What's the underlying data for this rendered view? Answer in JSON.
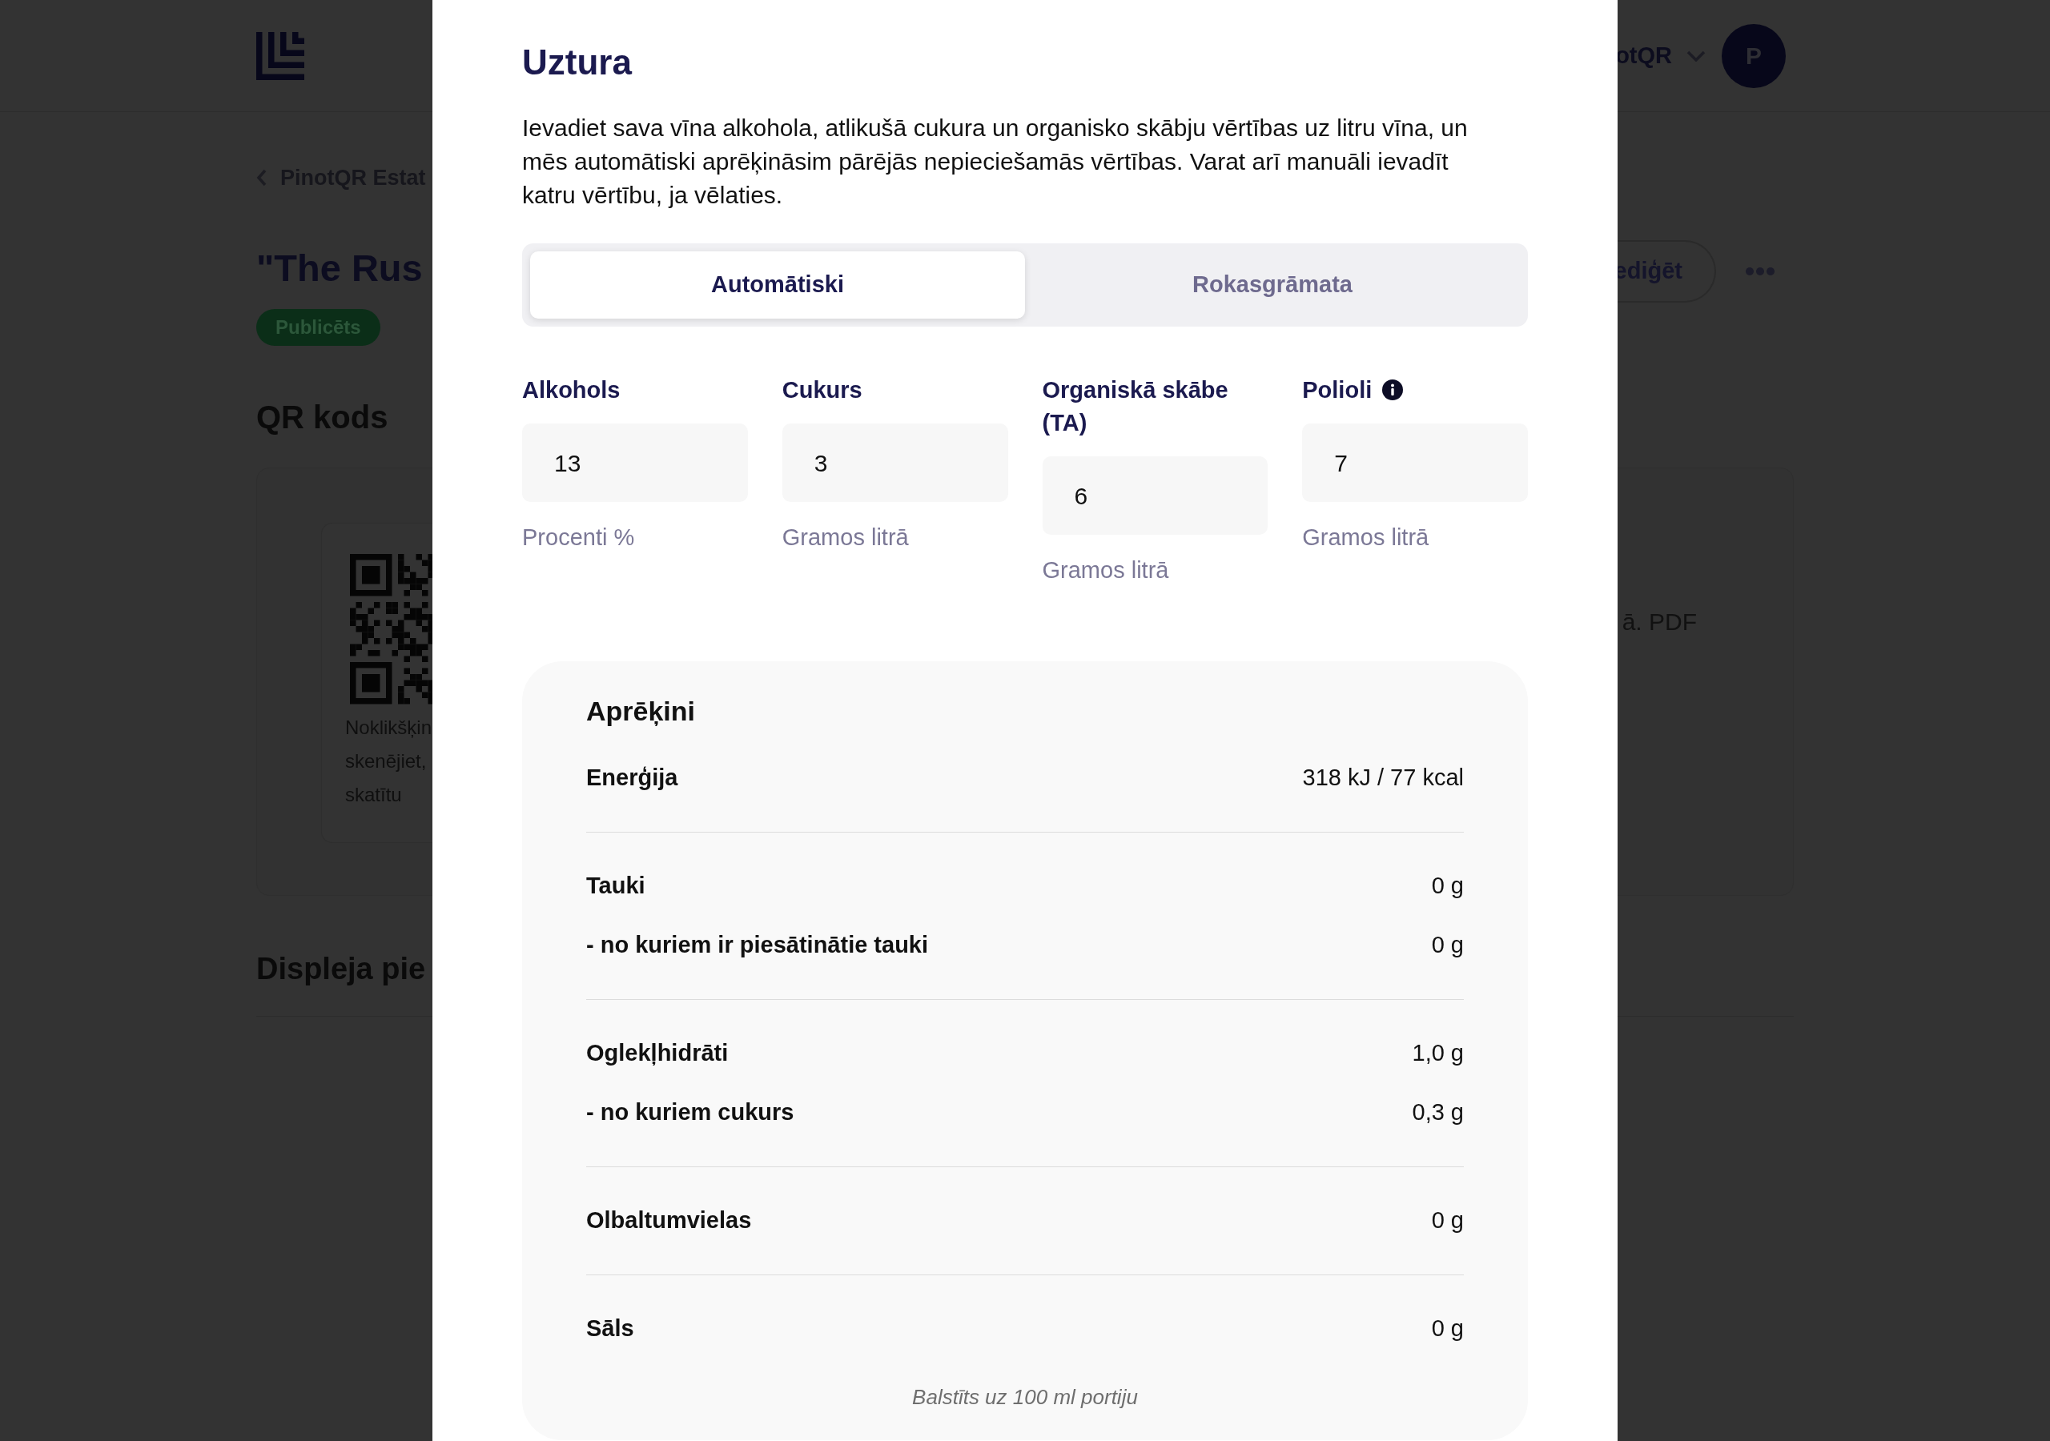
{
  "header": {
    "account": "otQR",
    "avatar_initial": "P"
  },
  "page": {
    "breadcrumb": "PinotQR Estat",
    "title": "\"The Rus",
    "status_badge": "Publicēts",
    "edit_button": "ediģēt",
    "qr_section": {
      "heading": "QR kods",
      "hint_lines": [
        "Noklikšķin",
        "skenējiet,",
        "skatītu"
      ],
      "download_note": "ā. PDF"
    },
    "display_heading": "Displeja pie"
  },
  "modal": {
    "title": "Uztura",
    "description": "Ievadiet sava vīna alkohola, atlikušā cukura un organisko skābju vērtības uz litru vīna, un mēs automātiski aprēķināsim pārējās nepieciešamās vērtības. Varat arī manuāli ievadīt katru vērtību, ja vēlaties.",
    "tabs": [
      {
        "label": "Automātiski",
        "selected": true
      },
      {
        "label": "Rokasgrāmata",
        "selected": false
      }
    ],
    "fields": [
      {
        "label": "Alkohols",
        "value": "13",
        "unit": "Procenti %",
        "info": false
      },
      {
        "label": "Cukurs",
        "value": "3",
        "unit": "Gramos litrā",
        "info": false
      },
      {
        "label": "Organiskā skābe (TA)",
        "value": "6",
        "unit": "Gramos litrā",
        "info": false
      },
      {
        "label": "Polioli",
        "value": "7",
        "unit": "Gramos litrā",
        "info": true
      }
    ],
    "calculations": {
      "title": "Aprēķini",
      "groups": [
        {
          "rows": [
            {
              "label": "Enerģija",
              "value": "318 kJ / 77 kcal"
            }
          ]
        },
        {
          "rows": [
            {
              "label": "Tauki",
              "value": "0 g"
            },
            {
              "label": "- no kuriem ir piesātinātie tauki",
              "value": "0 g"
            }
          ]
        },
        {
          "rows": [
            {
              "label": "Oglekļhidrāti",
              "value": "1,0 g"
            },
            {
              "label": "- no kuriem cukurs",
              "value": "0,3 g"
            }
          ]
        },
        {
          "rows": [
            {
              "label": "Olbaltumvielas",
              "value": "0 g"
            }
          ]
        },
        {
          "rows": [
            {
              "label": "Sāls",
              "value": "0 g"
            }
          ]
        }
      ],
      "footnote": "Balstīts uz 100 ml portiju"
    }
  }
}
